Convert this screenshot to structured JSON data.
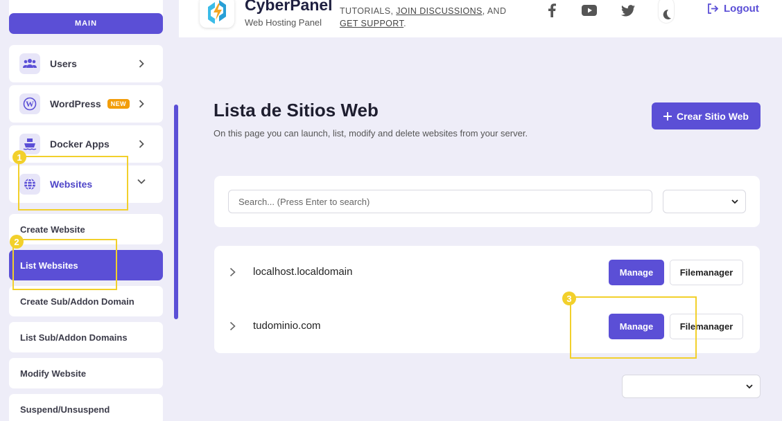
{
  "sidebar": {
    "section_label": "MAIN",
    "items": [
      {
        "label": "Users",
        "icon": "users-icon"
      },
      {
        "label": "WordPress",
        "icon": "wordpress-icon",
        "badge": "NEW"
      },
      {
        "label": "Docker Apps",
        "icon": "docker-icon"
      },
      {
        "label": "Websites",
        "icon": "globe-icon",
        "expanded": true
      }
    ],
    "sub_items": [
      {
        "label": "Create Website"
      },
      {
        "label": "List Websites",
        "active": true
      },
      {
        "label": "Create Sub/Addon Domain"
      },
      {
        "label": "List Sub/Addon Domains"
      },
      {
        "label": "Modify Website"
      },
      {
        "label": "Suspend/Unsuspend"
      }
    ]
  },
  "header": {
    "brand_title": "CyberPanel",
    "brand_subtitle": "Web Hosting Panel",
    "links_line1_prefix": "TUTORIALS, ",
    "links_join": "JOIN DISCUSSIONS",
    "links_line1_suffix": ", AND",
    "links_support": "GET SUPPORT",
    "links_line2_suffix": ".",
    "social_icons": [
      "facebook-icon",
      "youtube-icon",
      "twitter-icon"
    ],
    "theme_icon": "moon-icon",
    "logout_label": "Logout"
  },
  "main": {
    "title": "Lista de Sitios Web",
    "description": "On this page you can launch, list, modify and delete websites from your server.",
    "create_button": "Crear Sitio Web",
    "search_placeholder": "Search... (Press Enter to search)",
    "websites": [
      {
        "domain": "localhost.localdomain",
        "manage": "Manage",
        "filemanager": "Filemanager"
      },
      {
        "domain": "tudominio.com",
        "manage": "Manage",
        "filemanager": "Filemanager"
      }
    ]
  },
  "annotations": [
    "1",
    "2",
    "3"
  ],
  "colors": {
    "accent": "#5b4fd6",
    "annotation": "#f2d02b",
    "badge": "#f29d0a",
    "background": "#eeedf8"
  }
}
